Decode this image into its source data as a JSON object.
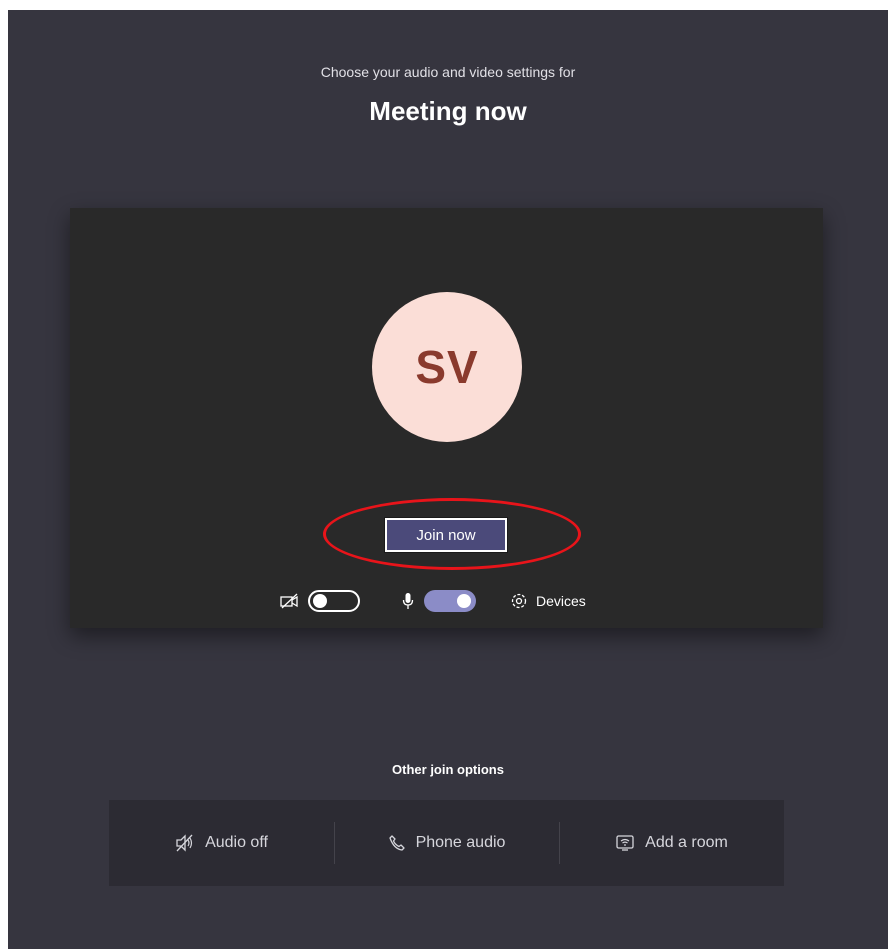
{
  "header": {
    "subtitle": "Choose your audio and video settings for",
    "title": "Meeting now"
  },
  "preview": {
    "avatar_initials": "SV",
    "join_button_label": "Join now",
    "controls": {
      "camera_icon": "camera-off-icon",
      "camera_toggle_on": false,
      "mic_icon": "microphone-icon",
      "mic_toggle_on": true,
      "devices_icon": "gear-icon",
      "devices_label": "Devices"
    }
  },
  "other_join": {
    "label": "Other join options",
    "options": [
      {
        "icon": "speaker-off-icon",
        "label": "Audio off"
      },
      {
        "icon": "phone-icon",
        "label": "Phone audio"
      },
      {
        "icon": "cast-room-icon",
        "label": "Add a room"
      }
    ]
  },
  "colors": {
    "background": "#36353f",
    "preview_bg": "#292929",
    "avatar_bg": "#fbded7",
    "avatar_text": "#8a3a2d",
    "accent": "#8b8cc7",
    "join_button": "#4b4a7a",
    "highlight": "#e8141a"
  }
}
